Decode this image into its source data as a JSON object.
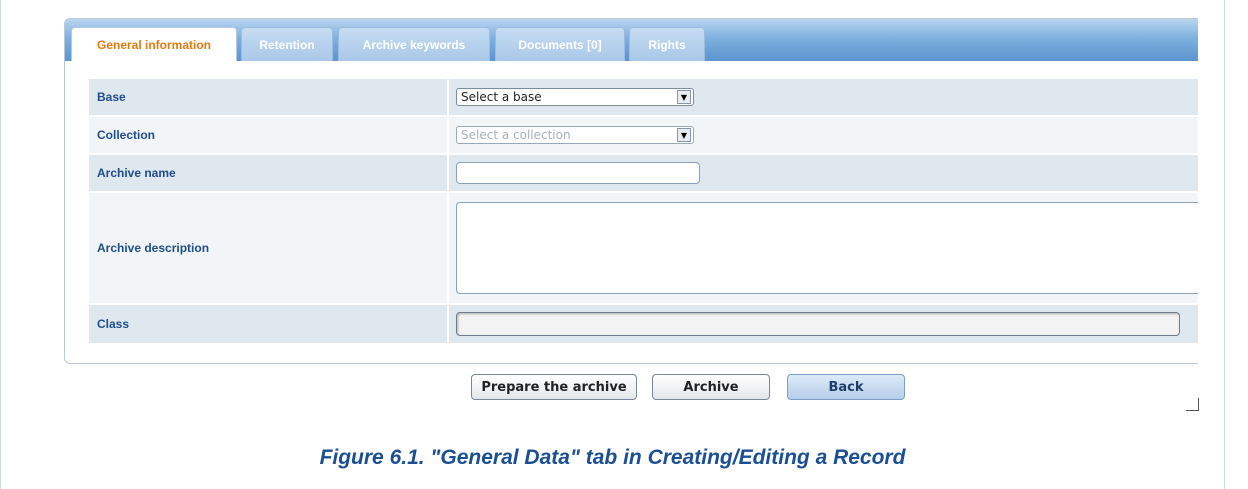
{
  "tabs": [
    {
      "label": "General information",
      "active": true
    },
    {
      "label": "Retention",
      "active": false
    },
    {
      "label": "Archive keywords",
      "active": false
    },
    {
      "label": "Documents [0]",
      "active": false
    },
    {
      "label": "Rights",
      "active": false
    }
  ],
  "form": {
    "base": {
      "label": "Base",
      "value": "Select a base"
    },
    "collection": {
      "label": "Collection",
      "value": "Select a collection"
    },
    "archive_name": {
      "label": "Archive name",
      "value": ""
    },
    "archive_description": {
      "label": "Archive description",
      "value": ""
    },
    "class": {
      "label": "Class",
      "value": ""
    }
  },
  "buttons": {
    "prepare": "Prepare the archive",
    "archive": "Archive",
    "back": "Back"
  },
  "caption": "Figure 6.1. \"General Data\" tab in Creating/Editing a Record",
  "colors": {
    "accent_active_tab": "#e07a12",
    "label_text": "#1f4d8a",
    "caption": "#1b4f93",
    "tabbar": "#5b94cf"
  }
}
